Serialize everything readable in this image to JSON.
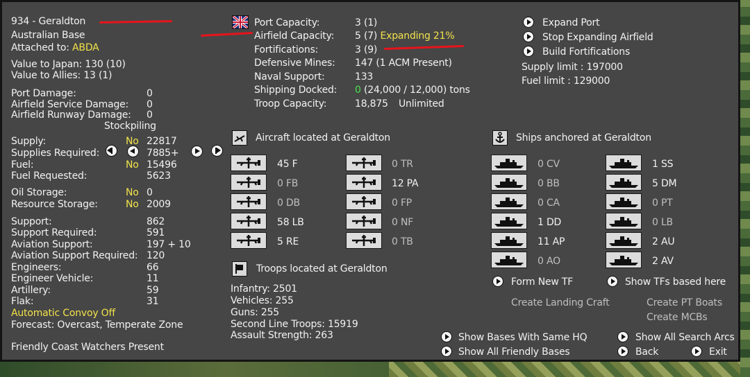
{
  "base": {
    "title": "934 - Geraldton",
    "type": "Australian Base",
    "attached_label": "Attached to:",
    "attached_value": "ABDA",
    "value_japan": "Value to Japan: 130 (10)",
    "value_allies": "Value to Allies: 13 (1)"
  },
  "damage": [
    {
      "label": "Port Damage:",
      "value": "0"
    },
    {
      "label": "Airfield Service Damage:",
      "value": "0"
    },
    {
      "label": "Airfield Runway Damage:",
      "value": "0"
    }
  ],
  "stockpiling_label": "Stockpiling",
  "supply": {
    "supply_label": "Supply:",
    "supply_stock": "No",
    "supply_value": "22817",
    "required_label": "Supplies Required:",
    "required_value": "7885+",
    "fuel_label": "Fuel:",
    "fuel_stock": "No",
    "fuel_value": "15496",
    "fuel_req_label": "Fuel Requested:",
    "fuel_req_value": "5623",
    "oil_label": "Oil Storage:",
    "oil_stock": "No",
    "oil_value": "0",
    "res_label": "Resource Storage:",
    "res_stock": "No",
    "res_value": "2009"
  },
  "support": [
    {
      "label": "Support:",
      "value": "862"
    },
    {
      "label": "Support Required:",
      "value": "591"
    },
    {
      "label": "Aviation Support:",
      "value": "197 + 10"
    },
    {
      "label": "Aviation Support Required:",
      "value": "120"
    },
    {
      "label": "Engineers:",
      "value": "66"
    },
    {
      "label": "Engineer Vehicle:",
      "value": "11"
    },
    {
      "label": "Artillery:",
      "value": "59"
    },
    {
      "label": "Flak:",
      "value": "31"
    }
  ],
  "convoy": "Automatic Convoy Off",
  "forecast": "Forecast: Overcast, Temperate Zone",
  "coast_watchers": "Friendly Coast Watchers Present",
  "capacity": {
    "port_label": "Port Capacity:",
    "port_value": "3 (1)",
    "airfield_label": "Airfield Capacity:",
    "airfield_value": "5 (7)",
    "airfield_expanding": "Expanding 21%",
    "fort_label": "Fortifications:",
    "fort_value": "3 (9)",
    "mines_label": "Defensive Mines:",
    "mines_value": "147 (1 ACM Present)",
    "naval_label": "Naval Support:",
    "naval_value": "133",
    "shipping_label": "Shipping Docked:",
    "shipping_green": "0",
    "shipping_rest": "(24,000 / 12,000) tons",
    "troop_label": "Troop Capacity:",
    "troop_value": "18,875",
    "troop_extra": "Unlimited"
  },
  "actions": {
    "expand_port": "Expand Port",
    "stop_airfield": "Stop Expanding Airfield",
    "build_fort": "Build Fortifications",
    "supply_limit": "Supply limit : 197000",
    "fuel_limit": "Fuel limit : 129000"
  },
  "aircraft": {
    "header": "Aircraft located at Geraldton",
    "left": [
      "45 F",
      "0 FB",
      "0 DB",
      "58 LB",
      "5 RE"
    ],
    "right": [
      "0 TR",
      "12 PA",
      "0 FP",
      "0 NF",
      "0 TB"
    ]
  },
  "ships": {
    "header": "Ships anchored at Geraldton",
    "left": [
      "0 CV",
      "0 BB",
      "0 CA",
      "1 DD",
      "11 AP",
      "0 AO"
    ],
    "right": [
      "1 SS",
      "5 DM",
      "0 PT",
      "0 LB",
      "2 AU",
      "2 AV"
    ],
    "form_tf": "Form New TF",
    "show_tfs": "Show TFs based here",
    "landing_craft": "Create Landing Craft",
    "pt_boats": "Create PT Boats",
    "mcbs": "Create MCBs"
  },
  "troops": {
    "header": "Troops located at Geraldton",
    "lines": [
      "Infantry: 2501",
      "Vehicles: 255",
      "Guns: 255",
      "Second Line Troops: 15919",
      "Assault Strength: 263"
    ]
  },
  "bottom": {
    "same_hq": "Show Bases With Same HQ",
    "friendly": "Show All Friendly Bases",
    "search_arcs": "Show All Search Arcs",
    "back": "Back",
    "exit": "Exit"
  },
  "colors": {
    "panel": "#464646",
    "yellow": "#f2e24a",
    "green": "#47e24a",
    "annotation": "#e8141b"
  }
}
